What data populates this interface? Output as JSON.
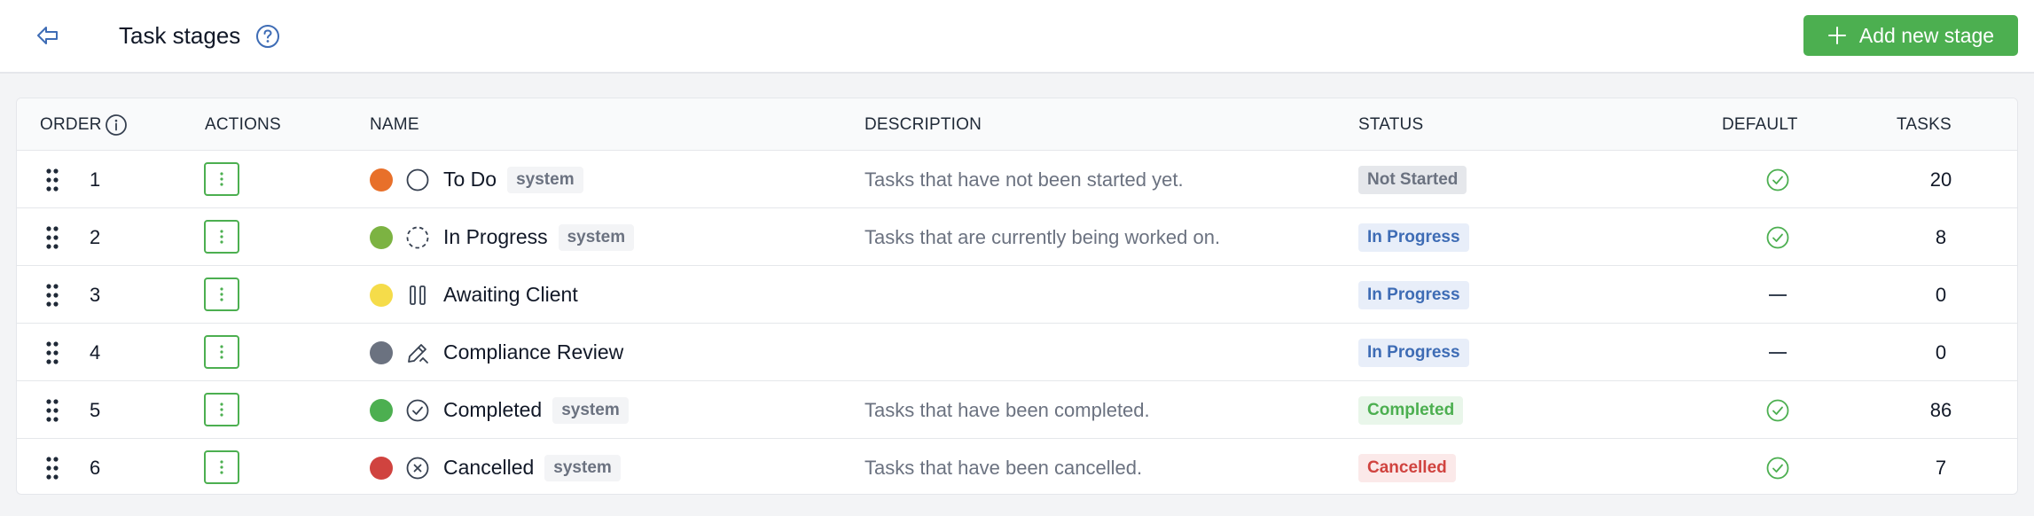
{
  "header": {
    "title": "Task stages",
    "add_label": "Add new stage"
  },
  "columns": {
    "order": "ORDER",
    "actions": "ACTIONS",
    "name": "NAME",
    "description": "DESCRIPTION",
    "status": "STATUS",
    "default": "DEFAULT",
    "tasks": "TASKS"
  },
  "rows": [
    {
      "order": "1",
      "color": "#e8702a",
      "icon": "circle-icon",
      "name": "To Do",
      "system": "system",
      "description": "Tasks that have not been started yet.",
      "status": "Not Started",
      "status_type": "neutral",
      "default": true,
      "tasks": "20"
    },
    {
      "order": "2",
      "color": "#7cb342",
      "icon": "dashed-circle-icon",
      "name": "In Progress",
      "system": "system",
      "description": "Tasks that are currently being worked on.",
      "status": "In Progress",
      "status_type": "progress",
      "default": true,
      "tasks": "8"
    },
    {
      "order": "3",
      "color": "#f5dc4a",
      "icon": "pause-icon",
      "name": "Awaiting Client",
      "system": "",
      "description": "",
      "status": "In Progress",
      "status_type": "progress",
      "default": false,
      "tasks": "0"
    },
    {
      "order": "4",
      "color": "#6b7280",
      "icon": "edit-icon",
      "name": "Compliance Review",
      "system": "",
      "description": "",
      "status": "In Progress",
      "status_type": "progress",
      "default": false,
      "tasks": "0"
    },
    {
      "order": "5",
      "color": "#4caf50",
      "icon": "check-circle-icon",
      "name": "Completed",
      "system": "system",
      "description": "Tasks that have been completed.",
      "status": "Completed",
      "status_type": "completed",
      "default": true,
      "tasks": "86"
    },
    {
      "order": "6",
      "color": "#d0433f",
      "icon": "x-circle-icon",
      "name": "Cancelled",
      "system": "system",
      "description": "Tasks that have been cancelled.",
      "status": "Cancelled",
      "status_type": "cancelled",
      "default": true,
      "tasks": "7"
    }
  ],
  "colors": {
    "accent": "#4caf50",
    "neutral_bg": "#e5e7eb",
    "neutral_fg": "#6b7280",
    "progress_bg": "#e8eef9",
    "progress_fg": "#3e6cb5",
    "completed_bg": "#e9f6ea",
    "completed_fg": "#4caf50",
    "cancelled_bg": "#fbe9e9",
    "cancelled_fg": "#d0433f"
  }
}
